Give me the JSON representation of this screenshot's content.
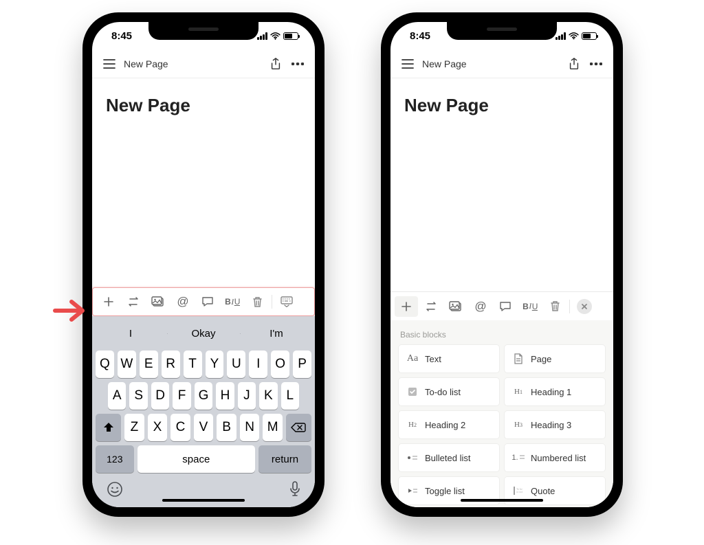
{
  "statusbar": {
    "time": "8:45"
  },
  "topbar": {
    "title": "New Page"
  },
  "page": {
    "title": "New Page"
  },
  "toolbar": {
    "plus": "plus",
    "convert": "convert",
    "image": "image",
    "mention": "@",
    "comment": "comment",
    "format": {
      "b": "B",
      "i": "I",
      "u": "U"
    },
    "delete": "delete",
    "keyboard_dismiss": "keyboard-dismiss",
    "close": "close"
  },
  "keyboard": {
    "suggestions": [
      "I",
      "Okay",
      "I'm"
    ],
    "row1": [
      "Q",
      "W",
      "E",
      "R",
      "T",
      "Y",
      "U",
      "I",
      "O",
      "P"
    ],
    "row2": [
      "A",
      "S",
      "D",
      "F",
      "G",
      "H",
      "J",
      "K",
      "L"
    ],
    "row3": [
      "Z",
      "X",
      "C",
      "V",
      "B",
      "N",
      "M"
    ],
    "numkey": "123",
    "space": "space",
    "return": "return"
  },
  "blocks": {
    "section": "Basic blocks",
    "items": [
      {
        "icon": "Aa",
        "label": "Text",
        "type": "serif"
      },
      {
        "icon": "page",
        "label": "Page",
        "type": "svg"
      },
      {
        "icon": "check",
        "label": "To-do list",
        "type": "svg"
      },
      {
        "icon": "H1",
        "label": "Heading 1",
        "type": "serif-small"
      },
      {
        "icon": "H2",
        "label": "Heading 2",
        "type": "serif-small"
      },
      {
        "icon": "H3",
        "label": "Heading 3",
        "type": "serif-small"
      },
      {
        "icon": "bullet",
        "label": "Bulleted list",
        "type": "svg"
      },
      {
        "icon": "1.",
        "label": "Numbered list",
        "type": "text-small"
      },
      {
        "icon": "toggle",
        "label": "Toggle list",
        "type": "svg"
      },
      {
        "icon": "quote",
        "label": "Quote",
        "type": "svg"
      }
    ]
  }
}
